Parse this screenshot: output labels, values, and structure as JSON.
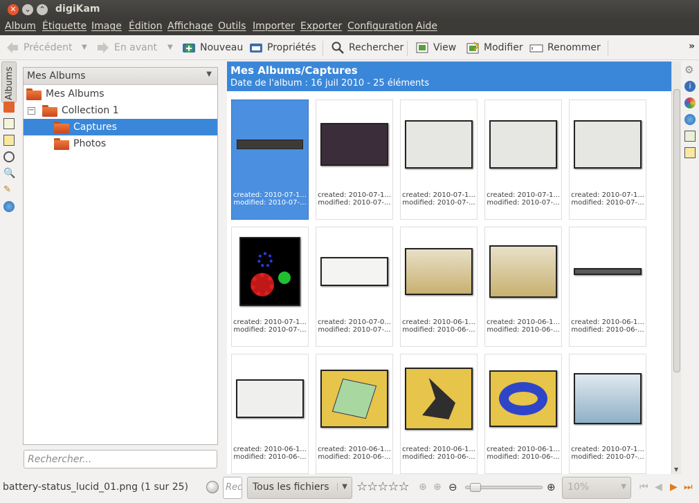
{
  "window": {
    "title": "digiKam"
  },
  "menu": [
    "Album",
    "Étiquette",
    "Image",
    "Édition",
    "Affichage",
    "Outils",
    "Importer",
    "Exporter",
    "Configuration",
    "Aide"
  ],
  "toolbar": {
    "back": "Précédent",
    "forward": "En avant",
    "new": "Nouveau",
    "properties": "Propriétés",
    "search": "Rechercher",
    "view": "View",
    "edit": "Modifier",
    "rename": "Renommer",
    "more": "»"
  },
  "lefttabs": {
    "albums": "Albums"
  },
  "albums": {
    "header": "Mes Albums",
    "root": "Mes Albums",
    "collection": "Collection 1",
    "captures": "Captures",
    "photos": "Photos",
    "search_placeholder": "Rechercher..."
  },
  "main": {
    "title": "Mes Albums/Captures",
    "subtitle": "Date de l'album : 16 juil 2010 - 25 éléments"
  },
  "thumbs": [
    {
      "created": "created: 2010-07-1...",
      "modified": "modified: 2010-07-..."
    },
    {
      "created": "created: 2010-07-1...",
      "modified": "modified: 2010-07-..."
    },
    {
      "created": "created: 2010-07-1...",
      "modified": "modified: 2010-07-..."
    },
    {
      "created": "created: 2010-07-1...",
      "modified": "modified: 2010-07-..."
    },
    {
      "created": "created: 2010-07-1...",
      "modified": "modified: 2010-07-..."
    },
    {
      "created": "created: 2010-07-1...",
      "modified": "modified: 2010-07-..."
    },
    {
      "created": "created: 2010-07-0...",
      "modified": "modified: 2010-07-..."
    },
    {
      "created": "created: 2010-06-1...",
      "modified": "modified: 2010-06-..."
    },
    {
      "created": "created: 2010-06-1...",
      "modified": "modified: 2010-06-..."
    },
    {
      "created": "created: 2010-06-1...",
      "modified": "modified: 2010-06-..."
    },
    {
      "created": "created: 2010-06-1...",
      "modified": "modified: 2010-06-..."
    },
    {
      "created": "created: 2010-06-1...",
      "modified": "modified: 2010-06-..."
    },
    {
      "created": "created: 2010-06-1...",
      "modified": "modified: 2010-06-..."
    },
    {
      "created": "created: 2010-06-1...",
      "modified": "modified: 2010-06-..."
    },
    {
      "created": "created: 2010-07-1...",
      "modified": "modified: 2010-07-..."
    }
  ],
  "status": {
    "filename": "battery-status_lucid_01.png (1 sur 25)",
    "filter_placeholder": "Rec",
    "filetype": "Tous les fichiers",
    "stars": "☆☆☆☆☆",
    "zoom": "10%"
  },
  "colors": {
    "accent": "#3a87d9",
    "titlebar": "#3c3b37",
    "folder": "#e2632b"
  }
}
